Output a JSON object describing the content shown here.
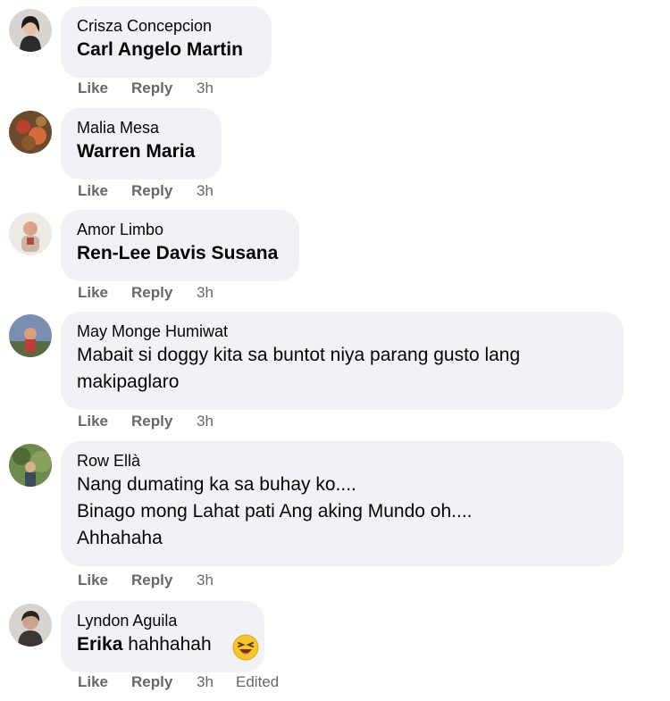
{
  "comments": [
    {
      "author": "Crisza Concepcion",
      "mention": "Carl Angelo Martin",
      "text": "",
      "like": "Like",
      "reply": "Reply",
      "time": "3h"
    },
    {
      "author": "Malia Mesa",
      "mention": "Warren Maria",
      "text": "",
      "like": "Like",
      "reply": "Reply",
      "time": "3h"
    },
    {
      "author": "Amor Limbo",
      "mention": "Ren-Lee Davis Susana",
      "text": "",
      "like": "Like",
      "reply": "Reply",
      "time": "3h"
    },
    {
      "author": "May Monge Humiwat",
      "lines": [
        "Mabait si doggy kita sa buntot niya parang gusto lang",
        "makipaglaro"
      ],
      "like": "Like",
      "reply": "Reply",
      "time": "3h"
    },
    {
      "author": "Row Ellà",
      "lines": [
        "Nang dumating ka sa buhay ko....",
        "Binago mong Lahat pati Ang aking Mundo oh....",
        "Ahhahaha"
      ],
      "like": "Like",
      "reply": "Reply",
      "time": "3h"
    },
    {
      "author": "Lyndon Aguila",
      "mention": "Erika",
      "text": "hahhahah",
      "emoji": "laughing-emoji",
      "like": "Like",
      "reply": "Reply",
      "time": "3h",
      "edited": "Edited"
    }
  ],
  "colors": {
    "bubble": "#f0f2f5",
    "action": "#65676b",
    "text": "#050505"
  }
}
